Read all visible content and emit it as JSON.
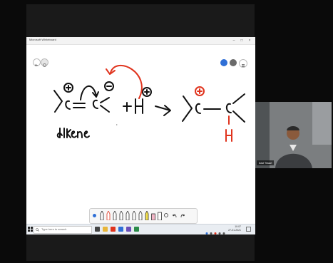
{
  "window": {
    "title": "Microsoft Whiteboard",
    "minimize": "–",
    "maximize": "□",
    "close": "×"
  },
  "whiteboard": {
    "ink_text_alkene": "alkene",
    "ink_text_plus": "+",
    "ink_text_h": "H"
  },
  "taskbar": {
    "search_placeholder": "Type here to search",
    "time": "10:07",
    "date": "27-01-2021"
  },
  "video": {
    "participant_name": "Atul Tiwari"
  },
  "colors": {
    "ink": "#111111",
    "red_ink": "#e0341e",
    "avatar": "#2f6fd6",
    "taskbar": "#e9edf2"
  }
}
